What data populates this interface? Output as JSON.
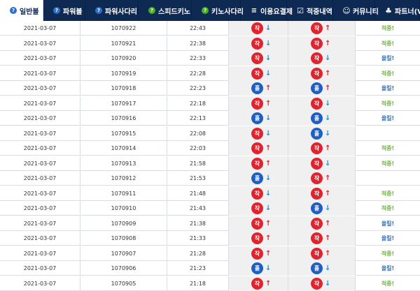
{
  "nav": {
    "tabs": [
      {
        "label": "일반볼",
        "icon": "question-icon",
        "active": true
      },
      {
        "label": "파워볼",
        "icon": "question-icon",
        "active": false
      },
      {
        "label": "파워사다리",
        "icon": "question-icon",
        "active": false
      },
      {
        "label": "스피드키노",
        "icon": "question-icon",
        "active": false
      },
      {
        "label": "키노사다리",
        "icon": "question-icon",
        "active": false
      },
      {
        "label": "이용요결제",
        "icon": "database-icon",
        "active": false
      },
      {
        "label": "적중내역",
        "icon": "checkbox-icon",
        "active": false
      },
      {
        "label": "커뮤니티",
        "icon": "smile-icon",
        "active": false
      },
      {
        "label": "파트너(V",
        "icon": "group-icon",
        "active": false
      }
    ]
  },
  "table": {
    "rows": [
      {
        "date": "2021-03-07",
        "no": "1070922",
        "time": "22:43",
        "a": "작",
        "a_dir": "down",
        "b": "작",
        "b_dir": "up",
        "result": "적중!",
        "result_type": "hit"
      },
      {
        "date": "2021-03-07",
        "no": "1070921",
        "time": "22:38",
        "a": "작",
        "a_dir": "down",
        "b": "작",
        "b_dir": "up",
        "result": "적중!",
        "result_type": "hit"
      },
      {
        "date": "2021-03-07",
        "no": "1070920",
        "time": "22:33",
        "a": "작",
        "a_dir": "down",
        "b": "작",
        "b_dir": "down",
        "result": "올킬!",
        "result_type": "allkill"
      },
      {
        "date": "2021-03-07",
        "no": "1070919",
        "time": "22:28",
        "a": "작",
        "a_dir": "down",
        "b": "작",
        "b_dir": "up",
        "result": "적중!",
        "result_type": "hit"
      },
      {
        "date": "2021-03-07",
        "no": "1070918",
        "time": "22:23",
        "a": "홀",
        "a_dir": "up",
        "b": "홀",
        "b_dir": "up",
        "result": "올킬!",
        "result_type": "allkill"
      },
      {
        "date": "2021-03-07",
        "no": "1070917",
        "time": "22:18",
        "a": "작",
        "a_dir": "up",
        "b": "작",
        "b_dir": "down",
        "result": "적중!",
        "result_type": "hit"
      },
      {
        "date": "2021-03-07",
        "no": "1070916",
        "time": "22:13",
        "a": "홀",
        "a_dir": "down",
        "b": "홀",
        "b_dir": "down",
        "result": "올킬!",
        "result_type": "allkill"
      },
      {
        "date": "2021-03-07",
        "no": "1070915",
        "time": "22:08",
        "a": "작",
        "a_dir": "down",
        "b": "홀",
        "b_dir": "down",
        "result": "",
        "result_type": "none"
      },
      {
        "date": "2021-03-07",
        "no": "1070914",
        "time": "22:03",
        "a": "작",
        "a_dir": "up",
        "b": "작",
        "b_dir": "up",
        "result": "적중!",
        "result_type": "hit"
      },
      {
        "date": "2021-03-07",
        "no": "1070913",
        "time": "21:58",
        "a": "작",
        "a_dir": "up",
        "b": "작",
        "b_dir": "down",
        "result": "적중!",
        "result_type": "hit"
      },
      {
        "date": "2021-03-07",
        "no": "1070912",
        "time": "21:53",
        "a": "홀",
        "a_dir": "down",
        "b": "작",
        "b_dir": "up",
        "result": "",
        "result_type": "none"
      },
      {
        "date": "2021-03-07",
        "no": "1070911",
        "time": "21:48",
        "a": "작",
        "a_dir": "down",
        "b": "작",
        "b_dir": "up",
        "result": "적중!",
        "result_type": "hit"
      },
      {
        "date": "2021-03-07",
        "no": "1070910",
        "time": "21:43",
        "a": "작",
        "a_dir": "down",
        "b": "홀",
        "b_dir": "down",
        "result": "적중!",
        "result_type": "hit"
      },
      {
        "date": "2021-03-07",
        "no": "1070909",
        "time": "21:38",
        "a": "작",
        "a_dir": "up",
        "b": "작",
        "b_dir": "up",
        "result": "올킬!",
        "result_type": "allkill"
      },
      {
        "date": "2021-03-07",
        "no": "1070908",
        "time": "21:33",
        "a": "작",
        "a_dir": "up",
        "b": "작",
        "b_dir": "up",
        "result": "올킬!",
        "result_type": "allkill"
      },
      {
        "date": "2021-03-07",
        "no": "1070907",
        "time": "21:28",
        "a": "작",
        "a_dir": "up",
        "b": "작",
        "b_dir": "up",
        "result": "적중!",
        "result_type": "hit"
      },
      {
        "date": "2021-03-07",
        "no": "1070906",
        "time": "21:23",
        "a": "홀",
        "a_dir": "down",
        "b": "홀",
        "b_dir": "down",
        "result": "올킬!",
        "result_type": "allkill"
      },
      {
        "date": "2021-03-07",
        "no": "1070905",
        "time": "21:18",
        "a": "작",
        "a_dir": "up",
        "b": "작",
        "b_dir": "down",
        "result": "적중!",
        "result_type": "hit"
      }
    ]
  },
  "colors": {
    "nav_bg": "#0f2a52",
    "red_ball": "#e0242f",
    "blue_ball": "#1f5fc4",
    "hit_text": "#6cb33e",
    "allkill_text": "#2f6db0"
  }
}
